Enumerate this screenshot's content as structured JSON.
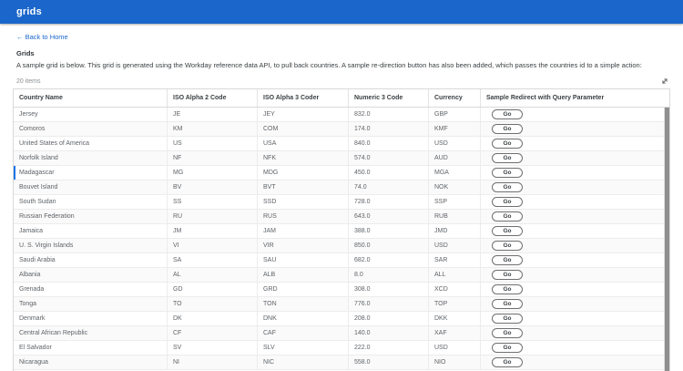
{
  "app_bar": {
    "title": "grids"
  },
  "nav": {
    "back_arrow": "←",
    "back_label": "Back to Home"
  },
  "page": {
    "heading": "Grids",
    "description": "A sample grid is below. This grid is generated using the Workday reference data API, to pull back countries. A sample re-direction button has also been added, which passes the countries id to a simple action:",
    "items_count": "20 items"
  },
  "colors": {
    "app_bar_blue": "#1b66cb",
    "link_blue": "#1a66cb",
    "row_highlight_blue": "#1a73e8"
  },
  "icons": {
    "expand": "expand-icon"
  },
  "table": {
    "columns": [
      "Country Name",
      "ISO Alpha 2 Code",
      "ISO Alpha 3 Coder",
      "Numeric 3 Code",
      "Currency",
      "Sample Redirect with Query Parameter"
    ],
    "go_label": "Go",
    "highlighted_index": 4,
    "rows": [
      {
        "country": "Jersey",
        "alpha2": "JE",
        "alpha3": "JEY",
        "numeric": "832.0",
        "currency": "GBP"
      },
      {
        "country": "Comoros",
        "alpha2": "KM",
        "alpha3": "COM",
        "numeric": "174.0",
        "currency": "KMF"
      },
      {
        "country": "United States of America",
        "alpha2": "US",
        "alpha3": "USA",
        "numeric": "840.0",
        "currency": "USD"
      },
      {
        "country": "Norfolk Island",
        "alpha2": "NF",
        "alpha3": "NFK",
        "numeric": "574.0",
        "currency": "AUD"
      },
      {
        "country": "Madagascar",
        "alpha2": "MG",
        "alpha3": "MDG",
        "numeric": "450.0",
        "currency": "MGA"
      },
      {
        "country": "Bouvet Island",
        "alpha2": "BV",
        "alpha3": "BVT",
        "numeric": "74.0",
        "currency": "NOK"
      },
      {
        "country": "South Sudan",
        "alpha2": "SS",
        "alpha3": "SSD",
        "numeric": "728.0",
        "currency": "SSP"
      },
      {
        "country": "Russian Federation",
        "alpha2": "RU",
        "alpha3": "RUS",
        "numeric": "643.0",
        "currency": "RUB"
      },
      {
        "country": "Jamaica",
        "alpha2": "JM",
        "alpha3": "JAM",
        "numeric": "388.0",
        "currency": "JMD"
      },
      {
        "country": "U. S. Virgin Islands",
        "alpha2": "VI",
        "alpha3": "VIR",
        "numeric": "850.0",
        "currency": "USD"
      },
      {
        "country": "Saudi Arabia",
        "alpha2": "SA",
        "alpha3": "SAU",
        "numeric": "682.0",
        "currency": "SAR"
      },
      {
        "country": "Albania",
        "alpha2": "AL",
        "alpha3": "ALB",
        "numeric": "8.0",
        "currency": "ALL"
      },
      {
        "country": "Grenada",
        "alpha2": "GD",
        "alpha3": "GRD",
        "numeric": "308.0",
        "currency": "XCD"
      },
      {
        "country": "Tonga",
        "alpha2": "TO",
        "alpha3": "TON",
        "numeric": "776.0",
        "currency": "TOP"
      },
      {
        "country": "Denmark",
        "alpha2": "DK",
        "alpha3": "DNK",
        "numeric": "208.0",
        "currency": "DKK"
      },
      {
        "country": "Central African Republic",
        "alpha2": "CF",
        "alpha3": "CAF",
        "numeric": "140.0",
        "currency": "XAF"
      },
      {
        "country": "El Salvador",
        "alpha2": "SV",
        "alpha3": "SLV",
        "numeric": "222.0",
        "currency": "USD"
      },
      {
        "country": "Nicaragua",
        "alpha2": "NI",
        "alpha3": "NIC",
        "numeric": "558.0",
        "currency": "NIO"
      }
    ]
  }
}
